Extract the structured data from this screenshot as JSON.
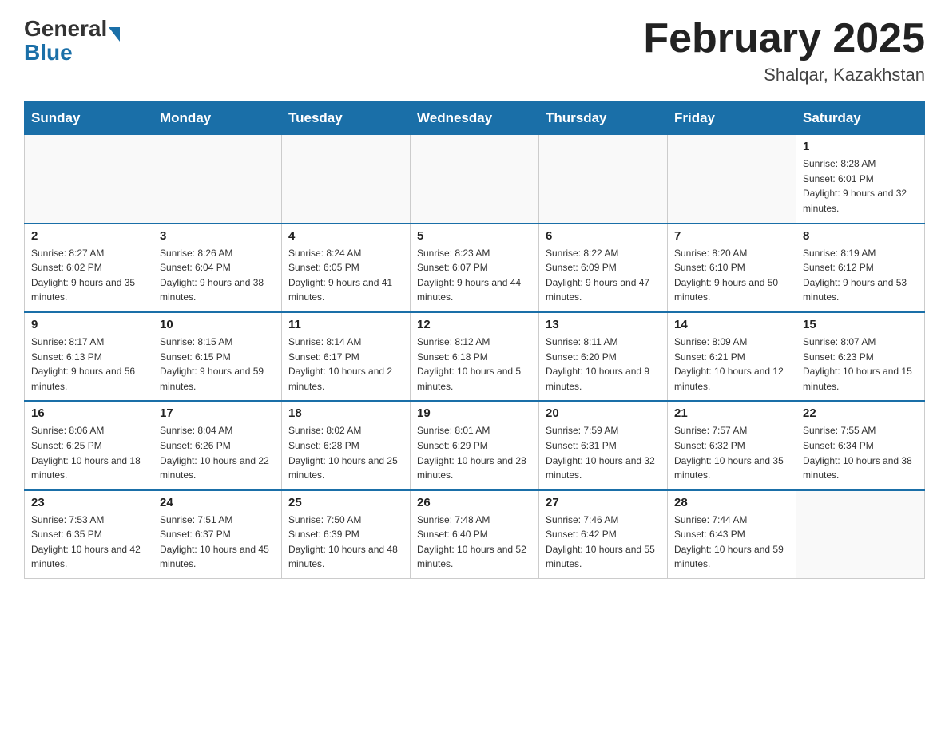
{
  "header": {
    "logo_general": "General",
    "logo_blue": "Blue",
    "month_title": "February 2025",
    "location": "Shalqar, Kazakhstan"
  },
  "weekdays": [
    "Sunday",
    "Monday",
    "Tuesday",
    "Wednesday",
    "Thursday",
    "Friday",
    "Saturday"
  ],
  "weeks": [
    [
      {
        "day": "",
        "info": ""
      },
      {
        "day": "",
        "info": ""
      },
      {
        "day": "",
        "info": ""
      },
      {
        "day": "",
        "info": ""
      },
      {
        "day": "",
        "info": ""
      },
      {
        "day": "",
        "info": ""
      },
      {
        "day": "1",
        "info": "Sunrise: 8:28 AM\nSunset: 6:01 PM\nDaylight: 9 hours and 32 minutes."
      }
    ],
    [
      {
        "day": "2",
        "info": "Sunrise: 8:27 AM\nSunset: 6:02 PM\nDaylight: 9 hours and 35 minutes."
      },
      {
        "day": "3",
        "info": "Sunrise: 8:26 AM\nSunset: 6:04 PM\nDaylight: 9 hours and 38 minutes."
      },
      {
        "day": "4",
        "info": "Sunrise: 8:24 AM\nSunset: 6:05 PM\nDaylight: 9 hours and 41 minutes."
      },
      {
        "day": "5",
        "info": "Sunrise: 8:23 AM\nSunset: 6:07 PM\nDaylight: 9 hours and 44 minutes."
      },
      {
        "day": "6",
        "info": "Sunrise: 8:22 AM\nSunset: 6:09 PM\nDaylight: 9 hours and 47 minutes."
      },
      {
        "day": "7",
        "info": "Sunrise: 8:20 AM\nSunset: 6:10 PM\nDaylight: 9 hours and 50 minutes."
      },
      {
        "day": "8",
        "info": "Sunrise: 8:19 AM\nSunset: 6:12 PM\nDaylight: 9 hours and 53 minutes."
      }
    ],
    [
      {
        "day": "9",
        "info": "Sunrise: 8:17 AM\nSunset: 6:13 PM\nDaylight: 9 hours and 56 minutes."
      },
      {
        "day": "10",
        "info": "Sunrise: 8:15 AM\nSunset: 6:15 PM\nDaylight: 9 hours and 59 minutes."
      },
      {
        "day": "11",
        "info": "Sunrise: 8:14 AM\nSunset: 6:17 PM\nDaylight: 10 hours and 2 minutes."
      },
      {
        "day": "12",
        "info": "Sunrise: 8:12 AM\nSunset: 6:18 PM\nDaylight: 10 hours and 5 minutes."
      },
      {
        "day": "13",
        "info": "Sunrise: 8:11 AM\nSunset: 6:20 PM\nDaylight: 10 hours and 9 minutes."
      },
      {
        "day": "14",
        "info": "Sunrise: 8:09 AM\nSunset: 6:21 PM\nDaylight: 10 hours and 12 minutes."
      },
      {
        "day": "15",
        "info": "Sunrise: 8:07 AM\nSunset: 6:23 PM\nDaylight: 10 hours and 15 minutes."
      }
    ],
    [
      {
        "day": "16",
        "info": "Sunrise: 8:06 AM\nSunset: 6:25 PM\nDaylight: 10 hours and 18 minutes."
      },
      {
        "day": "17",
        "info": "Sunrise: 8:04 AM\nSunset: 6:26 PM\nDaylight: 10 hours and 22 minutes."
      },
      {
        "day": "18",
        "info": "Sunrise: 8:02 AM\nSunset: 6:28 PM\nDaylight: 10 hours and 25 minutes."
      },
      {
        "day": "19",
        "info": "Sunrise: 8:01 AM\nSunset: 6:29 PM\nDaylight: 10 hours and 28 minutes."
      },
      {
        "day": "20",
        "info": "Sunrise: 7:59 AM\nSunset: 6:31 PM\nDaylight: 10 hours and 32 minutes."
      },
      {
        "day": "21",
        "info": "Sunrise: 7:57 AM\nSunset: 6:32 PM\nDaylight: 10 hours and 35 minutes."
      },
      {
        "day": "22",
        "info": "Sunrise: 7:55 AM\nSunset: 6:34 PM\nDaylight: 10 hours and 38 minutes."
      }
    ],
    [
      {
        "day": "23",
        "info": "Sunrise: 7:53 AM\nSunset: 6:35 PM\nDaylight: 10 hours and 42 minutes."
      },
      {
        "day": "24",
        "info": "Sunrise: 7:51 AM\nSunset: 6:37 PM\nDaylight: 10 hours and 45 minutes."
      },
      {
        "day": "25",
        "info": "Sunrise: 7:50 AM\nSunset: 6:39 PM\nDaylight: 10 hours and 48 minutes."
      },
      {
        "day": "26",
        "info": "Sunrise: 7:48 AM\nSunset: 6:40 PM\nDaylight: 10 hours and 52 minutes."
      },
      {
        "day": "27",
        "info": "Sunrise: 7:46 AM\nSunset: 6:42 PM\nDaylight: 10 hours and 55 minutes."
      },
      {
        "day": "28",
        "info": "Sunrise: 7:44 AM\nSunset: 6:43 PM\nDaylight: 10 hours and 59 minutes."
      },
      {
        "day": "",
        "info": ""
      }
    ]
  ]
}
